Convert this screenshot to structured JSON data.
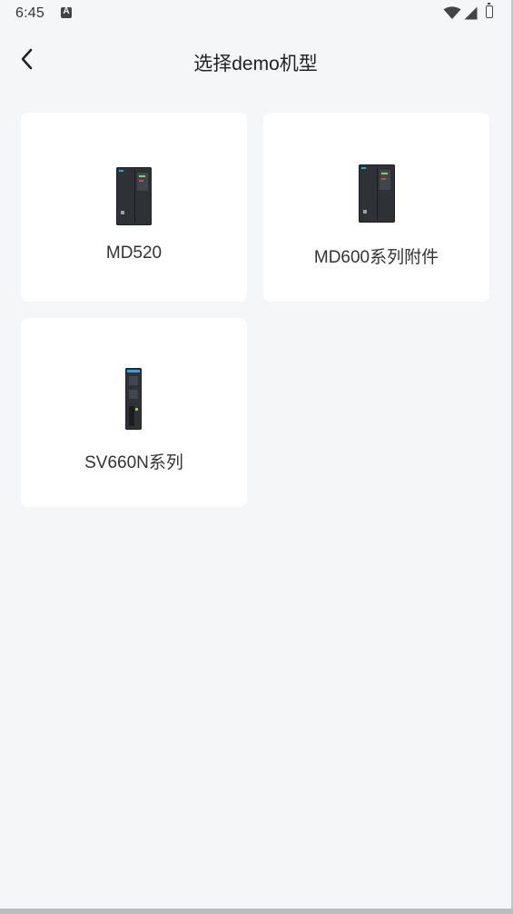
{
  "status_bar": {
    "time": "6:45"
  },
  "header": {
    "title": "选择demo机型"
  },
  "cards": [
    {
      "label": "MD520",
      "image": "md520-drive-image"
    },
    {
      "label": "MD600系列附件",
      "image": "md600-drive-image"
    },
    {
      "label": "SV660N系列",
      "image": "sv660n-servo-image"
    }
  ],
  "colors": {
    "background": "#f5f6f8",
    "card": "#ffffff",
    "text": "#222222",
    "device_body": "#2e3236",
    "accent_led": "#2aa6d9"
  }
}
